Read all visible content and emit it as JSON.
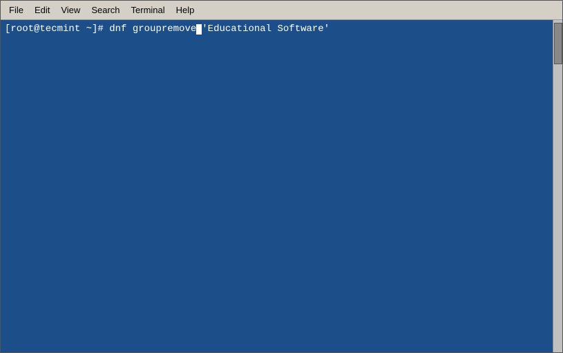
{
  "menubar": {
    "items": [
      {
        "id": "file",
        "label": "File"
      },
      {
        "id": "edit",
        "label": "Edit"
      },
      {
        "id": "view",
        "label": "View"
      },
      {
        "id": "search",
        "label": "Search"
      },
      {
        "id": "terminal",
        "label": "Terminal"
      },
      {
        "id": "help",
        "label": "Help"
      }
    ]
  },
  "terminal": {
    "prompt": "[root@tecmint ~]# ",
    "command": "dnf groupremove",
    "cursor_marker": "",
    "argument": "'Educational Software'"
  }
}
